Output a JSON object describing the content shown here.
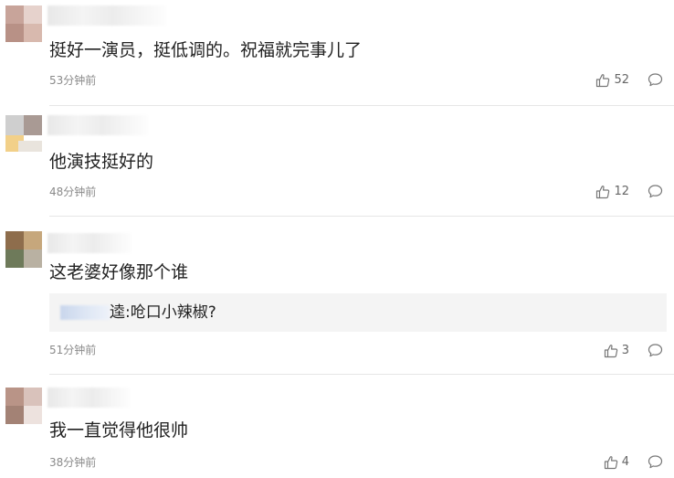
{
  "comments": [
    {
      "content": "挺好一演员，挺低调的。祝福就完事儿了",
      "time": "53分钟前",
      "likes": "52",
      "avatar_colors": [
        "#c8a49a",
        "#e6d2cc",
        "#b89186",
        "#d8b9ae"
      ]
    },
    {
      "content": "他演技挺好的",
      "time": "48分钟前",
      "likes": "12",
      "avatar_colors": [
        "#cfcfcf",
        "#a99a94",
        "#f2d089",
        "#e9e4dd"
      ]
    },
    {
      "content": "这老婆好像那个谁",
      "time": "51分钟前",
      "likes": "3",
      "avatar_colors": [
        "#8e6d4c",
        "#c6a77c",
        "#6e7a5a",
        "#b9b1a2"
      ],
      "reply": {
        "text": "逵:呛口小辣椒?"
      }
    },
    {
      "content": "我一直觉得他很帅",
      "time": "38分钟前",
      "likes": "4",
      "avatar_colors": [
        "#b99487",
        "#d9c2bb",
        "#a38275",
        "#ede2de"
      ]
    }
  ]
}
